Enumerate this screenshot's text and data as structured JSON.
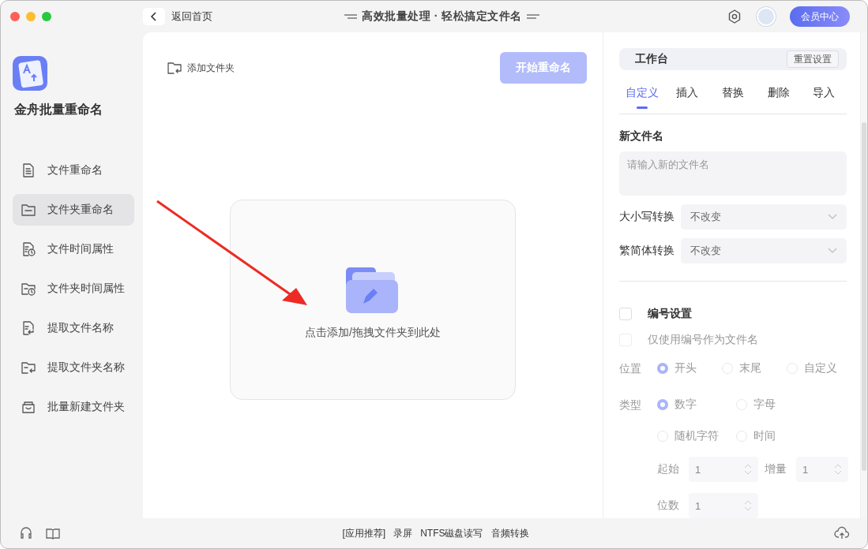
{
  "titlebar": {
    "back_label": "返回首页",
    "title": "高效批量处理 · 轻松搞定文件名",
    "member_button": "会员中心"
  },
  "sidebar": {
    "app_name": "金舟批量重命名",
    "items": [
      {
        "label": "文件重命名",
        "selected": false
      },
      {
        "label": "文件夹重命名",
        "selected": true
      },
      {
        "label": "文件时间属性",
        "selected": false
      },
      {
        "label": "文件夹时间属性",
        "selected": false
      },
      {
        "label": "提取文件名称",
        "selected": false
      },
      {
        "label": "提取文件夹名称",
        "selected": false
      },
      {
        "label": "批量新建文件夹",
        "selected": false
      }
    ]
  },
  "main": {
    "add_folder": "添加文件夹",
    "start_button": {
      "label": "开始重命名",
      "disabled": true
    },
    "dropzone_text": "点击添加/拖拽文件夹到此处"
  },
  "workbench": {
    "title": "工作台",
    "reset_button": "重置设置",
    "tabs": [
      {
        "label": "自定义",
        "selected": true
      },
      {
        "label": "插入",
        "selected": false
      },
      {
        "label": "替换",
        "selected": false
      },
      {
        "label": "删除",
        "selected": false
      },
      {
        "label": "导入",
        "selected": false
      }
    ],
    "new_name": {
      "label": "新文件名",
      "placeholder": "请输入新的文件名"
    },
    "selects": [
      {
        "label": "大小写转换",
        "value": "不改变"
      },
      {
        "label": "繁简体转换",
        "value": "不改变"
      }
    ],
    "numbering": {
      "label": "编号设置",
      "checked": false,
      "disabled": true,
      "only_number": {
        "label": "仅使用编号作为文件名",
        "checked": false
      },
      "position": {
        "label": "位置",
        "options": [
          {
            "label": "开头",
            "selected": true
          },
          {
            "label": "末尾",
            "selected": false
          },
          {
            "label": "自定义",
            "selected": false
          }
        ]
      },
      "type": {
        "label": "类型",
        "options": [
          {
            "label": "数字",
            "selected": true
          },
          {
            "label": "字母",
            "selected": false
          },
          {
            "label": "随机字符",
            "selected": false
          },
          {
            "label": "时间",
            "selected": false
          }
        ]
      },
      "spins": [
        {
          "label": "起始",
          "value": "1"
        },
        {
          "label": "增量",
          "value": "1"
        },
        {
          "label": "位数",
          "value": "1"
        }
      ]
    }
  },
  "footer": {
    "links": [
      "[应用推荐]",
      "录屏",
      "NTFS磁盘读写",
      "音频转换"
    ]
  }
}
